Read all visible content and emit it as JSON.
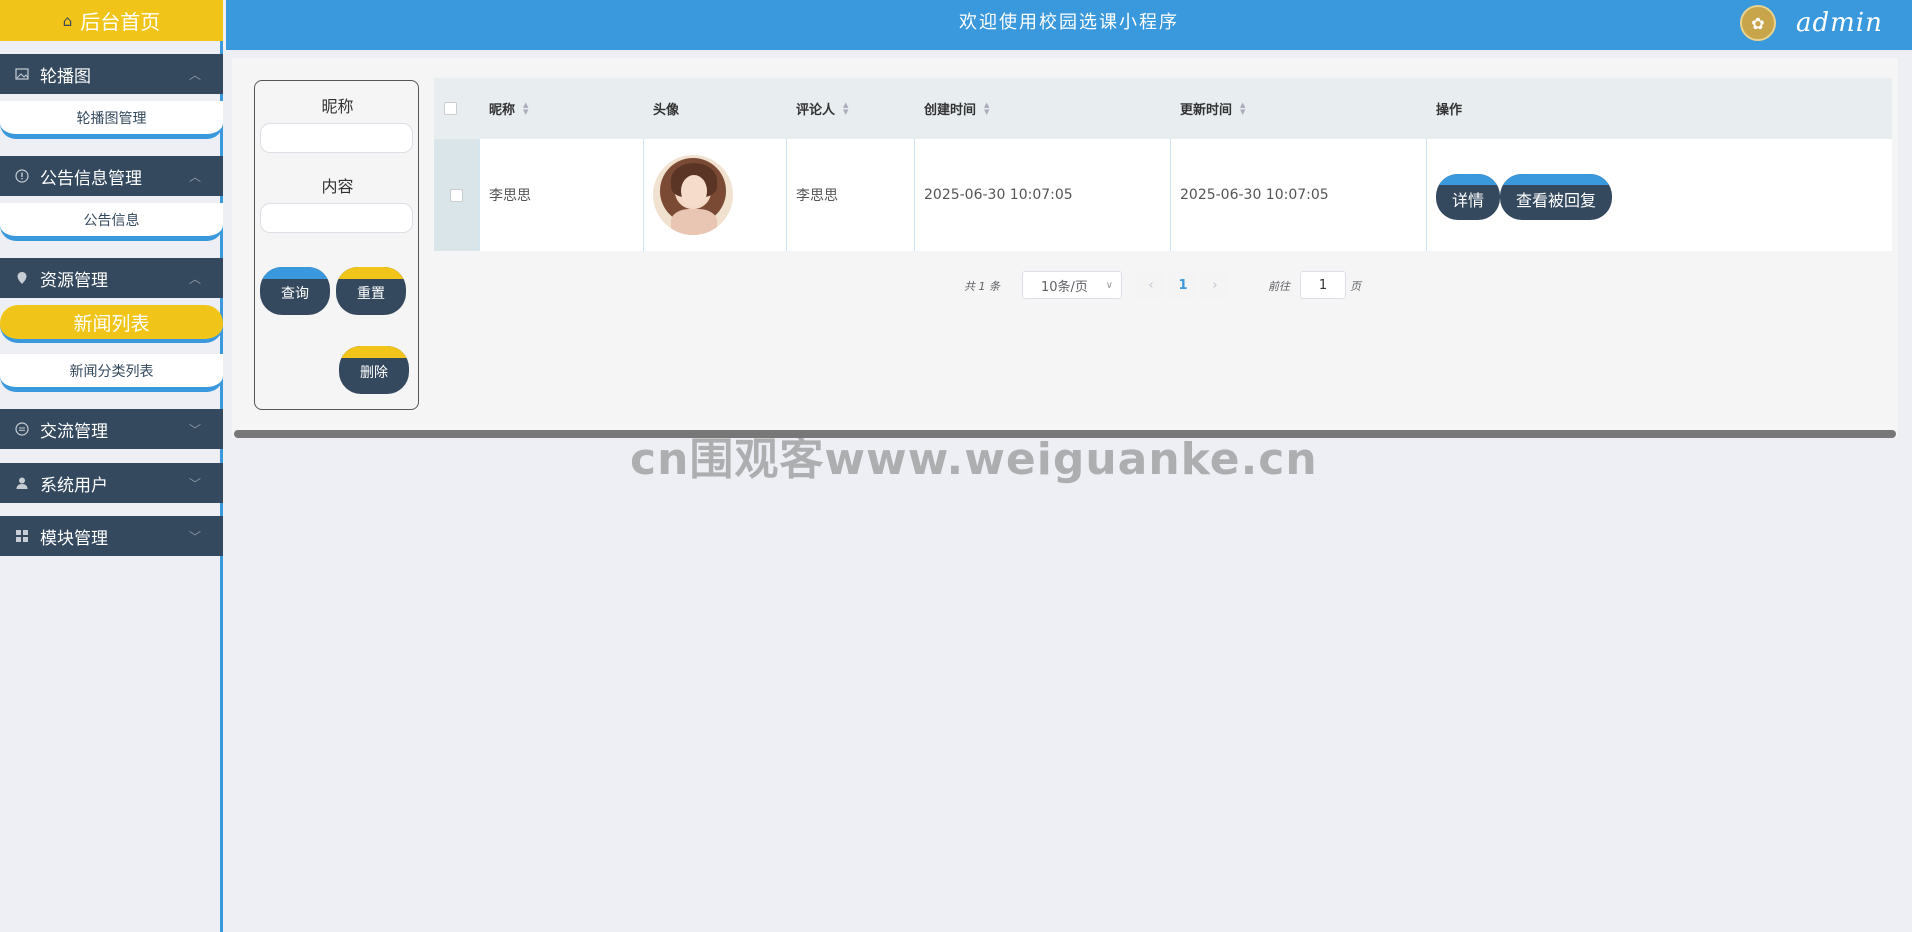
{
  "sidebar": {
    "home": "后台首页",
    "menus": [
      {
        "label": "轮播图",
        "icon": "image-icon",
        "chev": "^",
        "items": [
          "轮播图管理"
        ]
      },
      {
        "label": "公告信息管理",
        "icon": "info-icon",
        "chev": "^",
        "items": [
          "公告信息"
        ]
      },
      {
        "label": "资源管理",
        "icon": "pin-icon",
        "chev": "^",
        "items": [
          "新闻列表",
          "新闻分类列表"
        ]
      },
      {
        "label": "交流管理",
        "icon": "chat-icon",
        "chev": "v"
      },
      {
        "label": "系统用户",
        "icon": "user-icon",
        "chev": "v"
      },
      {
        "label": "模块管理",
        "icon": "grid-icon",
        "chev": "v"
      }
    ],
    "active_item": "新闻列表"
  },
  "header": {
    "title": "欢迎使用校园选课小程序",
    "user": "admin"
  },
  "search": {
    "nickname_label": "昵称",
    "content_label": "内容",
    "query_button": "查询",
    "reset_button": "重置",
    "delete_button": "删除"
  },
  "table": {
    "columns": [
      "昵称",
      "头像",
      "评论人",
      "创建时间",
      "更新时间",
      "操作"
    ],
    "rows": [
      {
        "nickname": "李思思",
        "commenter": "李思思",
        "created": "2025-06-30 10:07:05",
        "updated": "2025-06-30 10:07:05",
        "actions": [
          "详情",
          "查看被回复"
        ]
      }
    ]
  },
  "pagination": {
    "total": "共 1 条",
    "page_size": "10条/页",
    "current_page": "1",
    "goto_label": "前往",
    "goto_value": "1",
    "page_unit": "页"
  },
  "watermark": "cn围观客www.weiguanke.cn",
  "colors": {
    "accent_blue": "#3a98dc",
    "accent_yellow": "#f0c419",
    "navy": "#34495e"
  }
}
